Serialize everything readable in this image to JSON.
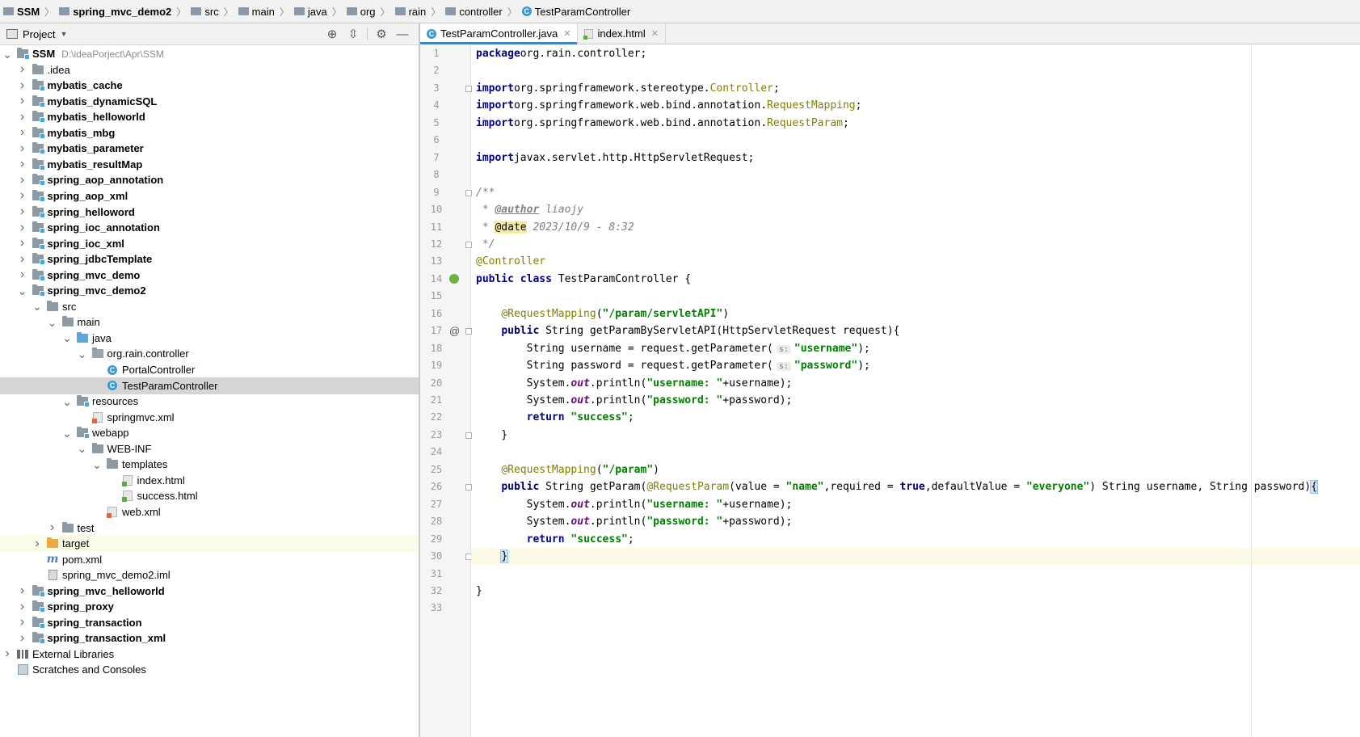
{
  "breadcrumbs": [
    "SSM",
    "spring_mvc_demo2",
    "src",
    "main",
    "java",
    "org",
    "rain",
    "controller",
    "TestParamController"
  ],
  "project_panel": {
    "title": "Project"
  },
  "tree": [
    {
      "label": "SSM",
      "path": "D:\\ideaPorject\\Apr\\SSM",
      "depth": 0,
      "arrow": "down",
      "icon": "module",
      "bold": true
    },
    {
      "label": ".idea",
      "depth": 1,
      "arrow": "right",
      "icon": "folder"
    },
    {
      "label": "mybatis_cache",
      "depth": 1,
      "arrow": "right",
      "icon": "module",
      "bold": true
    },
    {
      "label": "mybatis_dynamicSQL",
      "depth": 1,
      "arrow": "right",
      "icon": "module",
      "bold": true
    },
    {
      "label": "mybatis_helloworld",
      "depth": 1,
      "arrow": "right",
      "icon": "module",
      "bold": true
    },
    {
      "label": "mybatis_mbg",
      "depth": 1,
      "arrow": "right",
      "icon": "module",
      "bold": true
    },
    {
      "label": "mybatis_parameter",
      "depth": 1,
      "arrow": "right",
      "icon": "module",
      "bold": true
    },
    {
      "label": "mybatis_resultMap",
      "depth": 1,
      "arrow": "right",
      "icon": "module",
      "bold": true
    },
    {
      "label": "spring_aop_annotation",
      "depth": 1,
      "arrow": "right",
      "icon": "module",
      "bold": true
    },
    {
      "label": "spring_aop_xml",
      "depth": 1,
      "arrow": "right",
      "icon": "module",
      "bold": true
    },
    {
      "label": "spring_helloword",
      "depth": 1,
      "arrow": "right",
      "icon": "module",
      "bold": true
    },
    {
      "label": "spring_ioc_annotation",
      "depth": 1,
      "arrow": "right",
      "icon": "module",
      "bold": true
    },
    {
      "label": "spring_ioc_xml",
      "depth": 1,
      "arrow": "right",
      "icon": "module",
      "bold": true
    },
    {
      "label": "spring_jdbcTemplate",
      "depth": 1,
      "arrow": "right",
      "icon": "module",
      "bold": true
    },
    {
      "label": "spring_mvc_demo",
      "depth": 1,
      "arrow": "right",
      "icon": "module",
      "bold": true
    },
    {
      "label": "spring_mvc_demo2",
      "depth": 1,
      "arrow": "down",
      "icon": "module",
      "bold": true
    },
    {
      "label": "src",
      "depth": 2,
      "arrow": "down",
      "icon": "folder"
    },
    {
      "label": "main",
      "depth": 3,
      "arrow": "down",
      "icon": "folder"
    },
    {
      "label": "java",
      "depth": 4,
      "arrow": "down",
      "icon": "folder-blue"
    },
    {
      "label": "org.rain.controller",
      "depth": 5,
      "arrow": "down",
      "icon": "package"
    },
    {
      "label": "PortalController",
      "depth": 6,
      "arrow": "",
      "icon": "class"
    },
    {
      "label": "TestParamController",
      "depth": 6,
      "arrow": "",
      "icon": "class",
      "selected": true
    },
    {
      "label": "resources",
      "depth": 4,
      "arrow": "down",
      "icon": "folder-res"
    },
    {
      "label": "springmvc.xml",
      "depth": 5,
      "arrow": "",
      "icon": "xml"
    },
    {
      "label": "webapp",
      "depth": 4,
      "arrow": "down",
      "icon": "folder-web"
    },
    {
      "label": "WEB-INF",
      "depth": 5,
      "arrow": "down",
      "icon": "folder"
    },
    {
      "label": "templates",
      "depth": 6,
      "arrow": "down",
      "icon": "folder"
    },
    {
      "label": "index.html",
      "depth": 7,
      "arrow": "",
      "icon": "html"
    },
    {
      "label": "success.html",
      "depth": 7,
      "arrow": "",
      "icon": "html"
    },
    {
      "label": "web.xml",
      "depth": 6,
      "arrow": "",
      "icon": "xml"
    },
    {
      "label": "test",
      "depth": 3,
      "arrow": "right",
      "icon": "folder"
    },
    {
      "label": "target",
      "depth": 2,
      "arrow": "right",
      "icon": "folder-orange",
      "highlight": true
    },
    {
      "label": "pom.xml",
      "depth": 2,
      "arrow": "",
      "icon": "maven"
    },
    {
      "label": "spring_mvc_demo2.iml",
      "depth": 2,
      "arrow": "",
      "icon": "iml"
    },
    {
      "label": "spring_mvc_helloworld",
      "depth": 1,
      "arrow": "right",
      "icon": "module",
      "bold": true
    },
    {
      "label": "spring_proxy",
      "depth": 1,
      "arrow": "right",
      "icon": "module",
      "bold": true
    },
    {
      "label": "spring_transaction",
      "depth": 1,
      "arrow": "right",
      "icon": "module",
      "bold": true
    },
    {
      "label": "spring_transaction_xml",
      "depth": 1,
      "arrow": "right",
      "icon": "module",
      "bold": true
    },
    {
      "label": "External Libraries",
      "depth": 0,
      "arrow": "right",
      "icon": "libraries"
    },
    {
      "label": "Scratches and Consoles",
      "depth": 0,
      "arrow": "",
      "icon": "scratches"
    }
  ],
  "tabs": [
    {
      "label": "TestParamController.java",
      "icon": "class",
      "active": true
    },
    {
      "label": "index.html",
      "icon": "html",
      "active": false
    }
  ],
  "hint_label": "s:",
  "code_lines": [
    [
      [
        "kw",
        "package"
      ],
      [
        "",
        "org.rain.controller;"
      ]
    ],
    [],
    [
      [
        "kw",
        "import"
      ],
      [
        "",
        "org.springframework.stereotype."
      ],
      [
        "ann",
        "Controller"
      ],
      [
        "",
        ";"
      ]
    ],
    [
      [
        "kw",
        "import"
      ],
      [
        "",
        "org.springframework.web.bind.annotation."
      ],
      [
        "ann",
        "RequestMapping"
      ],
      [
        "",
        ";"
      ]
    ],
    [
      [
        "kw",
        "import"
      ],
      [
        "",
        "org.springframework.web.bind.annotation."
      ],
      [
        "ann",
        "RequestParam"
      ],
      [
        "",
        ";"
      ]
    ],
    [],
    [
      [
        "kw",
        "import"
      ],
      [
        "",
        "javax.servlet.http.HttpServletRequest;"
      ]
    ],
    [],
    [
      [
        "cmt",
        "/**"
      ]
    ],
    [
      [
        "cmt",
        " * "
      ],
      [
        "tag",
        "@author"
      ],
      [
        "cmt",
        " liaojy"
      ]
    ],
    [
      [
        "cmt",
        " * "
      ],
      [
        "tagbg",
        "@date"
      ],
      [
        "cmt",
        " 2023/10/9 - 8:32"
      ]
    ],
    [
      [
        "cmt",
        " */"
      ]
    ],
    [
      [
        "ann",
        "@Controller"
      ]
    ],
    [
      [
        "kw",
        "public class"
      ],
      [
        "",
        " TestParamController {"
      ]
    ],
    [],
    [
      [
        "",
        "    "
      ],
      [
        "ann",
        "@RequestMapping"
      ],
      [
        "",
        "("
      ],
      [
        "str",
        "\"/param/servletAPI\""
      ],
      [
        "",
        ")"
      ]
    ],
    [
      [
        "",
        "    "
      ],
      [
        "kw",
        "public"
      ],
      [
        "",
        " String getParamByServletAPI(HttpServletRequest request){"
      ]
    ],
    [
      [
        "",
        "        String username = request.getParameter("
      ],
      [
        "hint",
        "s:"
      ],
      [
        "str",
        "\"username\""
      ],
      [
        "",
        ");"
      ]
    ],
    [
      [
        "",
        "        String password = request.getParameter("
      ],
      [
        "hint",
        "s:"
      ],
      [
        "str",
        "\"password\""
      ],
      [
        "",
        ");"
      ]
    ],
    [
      [
        "",
        "        System."
      ],
      [
        "stat",
        "out"
      ],
      [
        "",
        ".println("
      ],
      [
        "str",
        "\"username: \""
      ],
      [
        "",
        "+username);"
      ]
    ],
    [
      [
        "",
        "        System."
      ],
      [
        "stat",
        "out"
      ],
      [
        "",
        ".println("
      ],
      [
        "str",
        "\"password: \""
      ],
      [
        "",
        "+password);"
      ]
    ],
    [
      [
        "",
        "        "
      ],
      [
        "kw",
        "return"
      ],
      [
        "",
        " "
      ],
      [
        "str",
        "\"success\""
      ],
      [
        "",
        ";"
      ]
    ],
    [
      [
        "",
        "    }"
      ]
    ],
    [],
    [
      [
        "",
        "    "
      ],
      [
        "ann",
        "@RequestMapping"
      ],
      [
        "",
        "("
      ],
      [
        "str",
        "\"/param\""
      ],
      [
        "",
        ")"
      ]
    ],
    [
      [
        "",
        "    "
      ],
      [
        "kw",
        "public"
      ],
      [
        "",
        " String getParam("
      ],
      [
        "ann",
        "@RequestParam"
      ],
      [
        "",
        "(value = "
      ],
      [
        "str",
        "\"name\""
      ],
      [
        "",
        ",required = "
      ],
      [
        "kw",
        "true"
      ],
      [
        "",
        ",defaultValue = "
      ],
      [
        "str",
        "\"everyone\""
      ],
      [
        "",
        ") String username, String password)"
      ],
      [
        "brace",
        "{"
      ]
    ],
    [
      [
        "",
        "        System."
      ],
      [
        "stat",
        "out"
      ],
      [
        "",
        ".println("
      ],
      [
        "str",
        "\"username: \""
      ],
      [
        "",
        "+username);"
      ]
    ],
    [
      [
        "",
        "        System."
      ],
      [
        "stat",
        "out"
      ],
      [
        "",
        ".println("
      ],
      [
        "str",
        "\"password: \""
      ],
      [
        "",
        "+password);"
      ]
    ],
    [
      [
        "",
        "        "
      ],
      [
        "kw",
        "return"
      ],
      [
        "",
        " "
      ],
      [
        "str",
        "\"success\""
      ],
      [
        "",
        ";"
      ]
    ],
    [
      [
        "",
        "    "
      ],
      [
        "brace",
        "}"
      ]
    ],
    [],
    [
      [
        "",
        "}"
      ]
    ],
    []
  ],
  "current_line": 30
}
